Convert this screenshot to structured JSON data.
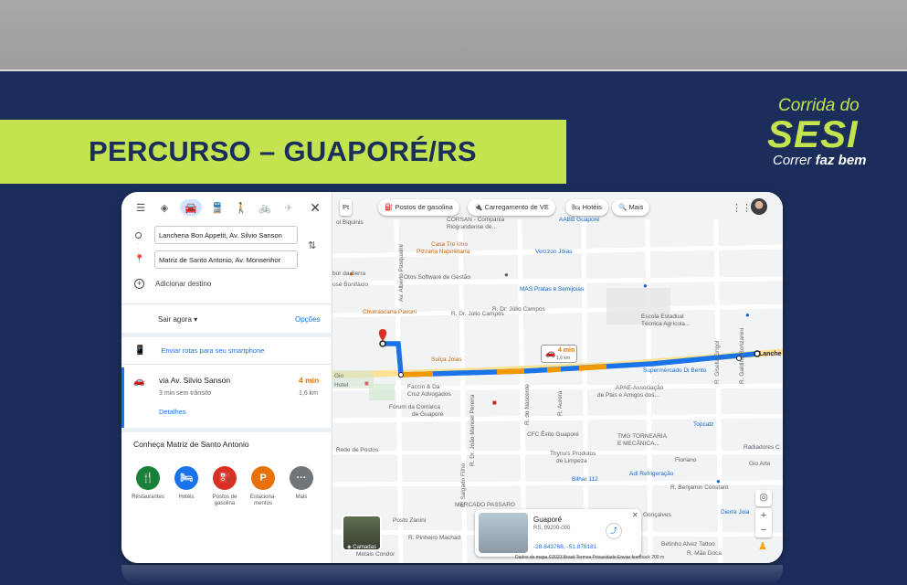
{
  "slide": {
    "title": "PERCURSO – GUAPORÉ/RS",
    "logo": {
      "line1": "Corrida do",
      "line2": "SESI",
      "line3a": "Correr ",
      "line3b": "faz bem"
    },
    "colors": {
      "navy": "#1b2d5b",
      "lime": "#c3e34f"
    }
  },
  "directions": {
    "modes": [
      "directions-icon",
      "car-icon",
      "transit-icon",
      "walk-icon",
      "bike-icon",
      "flight-icon"
    ],
    "origin": "Lancheria Bon Appetit, Av. Silvio Sanson",
    "destination": "Matriz de Santo Antonio, Av. Monsenhor",
    "add_destination": "Adicionar destino",
    "depart": "Sair agora",
    "options": "Opções",
    "send_to_phone": "Enviar rotas para seu smartphone",
    "route": {
      "via": "via Av. Silvio Sanson",
      "duration": "4 min",
      "traffic": "3 min sem trânsito",
      "distance": "1,6 km",
      "details": "Detalhes"
    },
    "explore_title": "Conheça Matriz de Santo Antonio",
    "places": [
      {
        "label": "Restaurantes",
        "icon": "restaurant-icon",
        "color": "#188038",
        "glyph": "🍴"
      },
      {
        "label": "Hotéis",
        "icon": "hotel-icon",
        "color": "#1a73e8",
        "glyph": "🛏"
      },
      {
        "label": "Postos de gasolina",
        "icon": "gas-icon",
        "color": "#d93025",
        "glyph": "⛽"
      },
      {
        "label": "Estaciona-mentos",
        "icon": "parking-icon",
        "color": "#e8710a",
        "glyph": "P"
      },
      {
        "label": "Mais",
        "icon": "more-icon",
        "color": "#70757a",
        "glyph": "···"
      }
    ]
  },
  "map": {
    "chips": [
      "Pt",
      "Postos de gasolina",
      "Carregamento de VE",
      "Hotéis",
      "Mais"
    ],
    "route_badge": {
      "duration": "4 min",
      "distance": "1,6 km"
    },
    "end_label": "Lanche",
    "labels": {
      "bijuinis": "ol Biquinis",
      "corsan": "CORSAN - Compania",
      "riograndense": "Riograndense de...",
      "aabb": "AABB Guaporé",
      "casa": "Casa Tre Uno",
      "pizzaria": "Pizzaria Napoletana",
      "verzzon": "Verzzon Jóias",
      "serra": "bor da Serra",
      "bonifacio": "osé Bonifácio",
      "otos": "Otos Software de Gestão",
      "mas": "MAS Pratas e Semijoias",
      "alberto": "Av. Alberto Pasqualini",
      "pavoni": "Churrascaria Pavoni",
      "julio1": "R. Dr. Júlio Campos",
      "julio2": "R. Dr. Júlio Campos",
      "escola": "Escola Estadual",
      "tecnica": "Técnica Agrícola...",
      "suica": "Suíça Joias",
      "supermercado": "Supermercado Di Bento",
      "faccin": "Faccin & Da",
      "cruz": "Cruz Advogados",
      "apae": "APAE-Associação",
      "apae2": "de Pais e Amigos dos...",
      "forum": "Fórum da Comarca",
      "forum2": "de Guaporé",
      "topcatz": "Topcatz",
      "cfc": "CFC Êxito Guaporé",
      "tmg": "TMG TORNEARIA",
      "tmg2": "E MECÂNICA...",
      "radiadores": "Radiadores C",
      "thynus": "Thynu's Produtos",
      "thynus2": "de Limpeza",
      "bilhar": "Bilhar 112",
      "adi": "Adi Refrigeração",
      "floriano": "Floriano",
      "benjamin": "R. Benjamin Constant",
      "rede": "Rede de Postos",
      "mercado": "MERCADO PASSARO",
      "posto": "Posto Zanini",
      "pinheiro": "R. Pinheiro Machad",
      "metais": "Metais Condor",
      "dierre": "Dierre Joia",
      "goncalves": "Gonçalves",
      "betinho": "Betinho Alvez Tattoo",
      "doca": "R. Mãe Doca",
      "gio": "Gio Arte",
      "galdino": "R. Galdino Bonzanini",
      "gisella": "R. Gisella Grigol",
      "aurora": "R. Aurora",
      "nascente": "R. do Nascente",
      "salgado": "R. Salgado Filho",
      "joao": "R. Dr. João Manoel Pereira",
      "hotel": "Hotel",
      "gio_left": "Gio"
    },
    "info_card": {
      "name": "Guaporé",
      "address": "RS, 99200-000",
      "coords": "-28.843768, -51.878181"
    },
    "layers": "Camadas",
    "footer": "Dados do mapa ©2023    Brasil    Termos    Privacidade    Enviar feedback    200 m"
  }
}
